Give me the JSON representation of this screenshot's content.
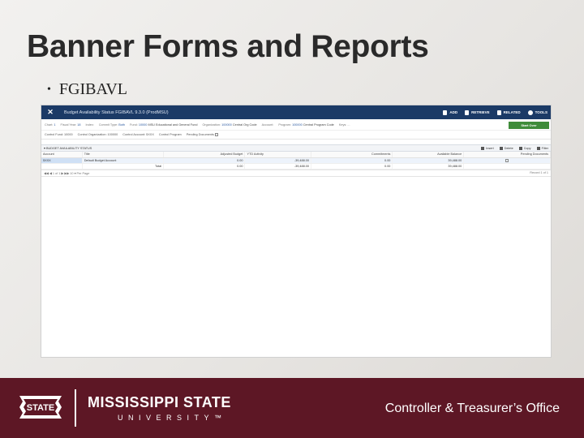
{
  "slide": {
    "title": "Banner Forms and Reports",
    "bullet": "FGIBAVL"
  },
  "app": {
    "window_title": "Budget Availability Status FGIBAVL 9.3.0 (ProdMSU)",
    "actions": [
      {
        "label": "ADD",
        "icon": "add-icon"
      },
      {
        "label": "RETRIEVE",
        "icon": "retrieve-icon"
      },
      {
        "label": "RELATED",
        "icon": "related-icon"
      },
      {
        "label": "TOOLS",
        "icon": "gear-icon"
      }
    ],
    "start_over": "Start Over",
    "key_block": {
      "chart_label": "Chart:",
      "chart_value": "1",
      "fiscal_year_label": "Fiscal Year:",
      "fiscal_year_value": "18",
      "index_label": "Index:",
      "commit_type_label": "Commit Type:",
      "commit_type_value": "Both",
      "fund_label": "Fund:",
      "fund_value": "10000",
      "fund_desc": "MSU Educational and General Fund",
      "org_label": "Organization:",
      "org_value": "100000",
      "org_desc": "Central Org Code",
      "account_label": "Account:",
      "program_label": "Program:",
      "program_value": "100000",
      "program_desc": "Central Program Code",
      "keys_label": "Keys: ..."
    },
    "control_row": {
      "ctrl_fund": "Control Fund: 10000",
      "ctrl_org": "Control Organization: 100000",
      "ctrl_acct": "Control Account: 5XXX",
      "ctrl_prog": "Control Program",
      "pending_docs": "Pending Documents"
    },
    "section_title": "▾ BUDGET AVAILABILITY STATUS",
    "section_tools": [
      "Insert",
      "Delete",
      "Copy",
      "Filter"
    ],
    "grid": {
      "columns": [
        "Account",
        "Title",
        "Adjusted Budget",
        "YTD Activity",
        "Commitments",
        "Available Balance",
        "Pending Documents"
      ],
      "rows": [
        {
          "account": "5XXX",
          "title": "Default Budget Account",
          "adjusted_budget": "0.00",
          "ytd_activity": "-39,488.00",
          "commitments": "0.00",
          "available_balance": "39,488.00",
          "pending_documents": ""
        }
      ],
      "total": {
        "label": "Total",
        "adjusted_budget": "0.00",
        "ytd_activity": "-39,488.00",
        "commitments": "0.00",
        "available_balance": "39,488.00"
      }
    },
    "pager": {
      "controls": "◀◀  ◀  1  of 1  ▶  ▶▶     10  ▾  Per Page",
      "record": "Record 1 of 1"
    }
  },
  "footer": {
    "logo_text": "STATE",
    "university_line1": "MISSISSIPPI STATE",
    "university_line2": "UNIVERSITY™",
    "office": "Controller & Treasurer’s Office"
  },
  "colors": {
    "footer_bg": "#5d1725",
    "app_bar": "#1b3a66",
    "start_over": "#3f8c3a"
  }
}
